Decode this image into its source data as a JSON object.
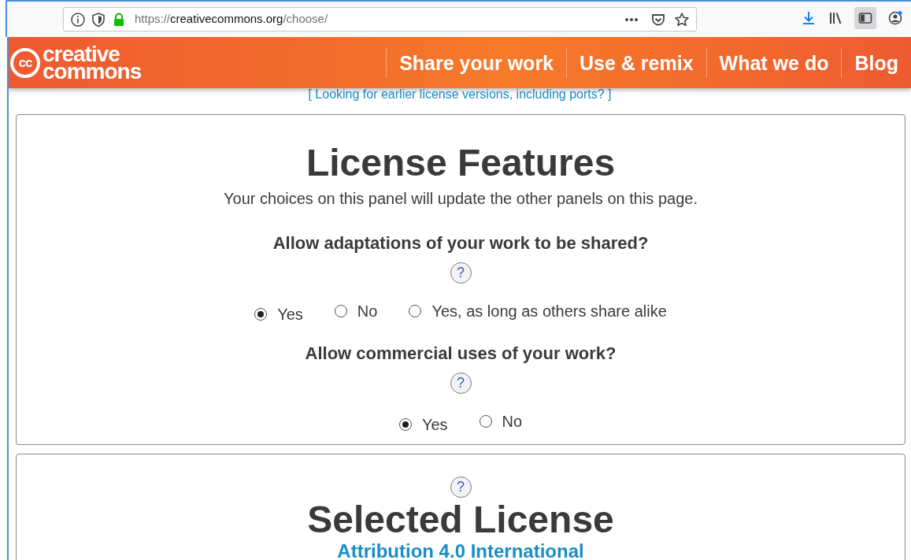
{
  "browser": {
    "url": {
      "scheme": "https://",
      "host": "creativecommons.org",
      "path": "/choose/"
    }
  },
  "header": {
    "logo": {
      "mark": "cc",
      "line_1": "creative",
      "line_2": "commons"
    },
    "nav": [
      "Share your work",
      "Use & remix",
      "What we do",
      "Blog"
    ]
  },
  "earlier_versions_link": "[ Looking for earlier license versions, including ports? ]",
  "license_features": {
    "title": "License Features",
    "subtitle": "Your choices on this panel will update the other panels on this page.",
    "questions": [
      {
        "text": "Allow adaptations of your work to be shared?",
        "help": "?",
        "options": [
          {
            "label": "Yes",
            "selected": true
          },
          {
            "label": "No",
            "selected": false
          },
          {
            "label": "Yes, as long as others share alike",
            "selected": false
          }
        ]
      },
      {
        "text": "Allow commercial uses of your work?",
        "help": "?",
        "options": [
          {
            "label": "Yes",
            "selected": true
          },
          {
            "label": "No",
            "selected": false
          }
        ]
      }
    ]
  },
  "selected_license": {
    "help": "?",
    "title": "Selected License",
    "license_link": "Attribution 4.0 International"
  }
}
